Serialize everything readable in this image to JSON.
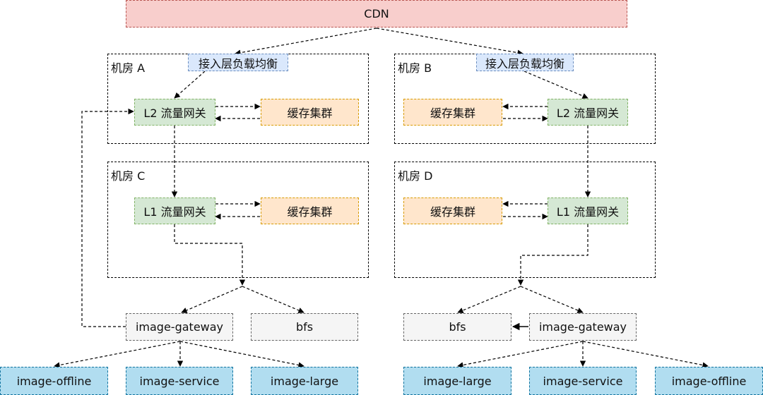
{
  "cdn": {
    "label": "CDN"
  },
  "room_a": {
    "label": "机房 A",
    "lb_label": "接入层负载均衡",
    "gw_label": "L2 流量网关",
    "cache_label": "缓存集群"
  },
  "room_b": {
    "label": "机房 B",
    "lb_label": "接入层负载均衡",
    "gw_label": "L2 流量网关",
    "cache_label": "缓存集群"
  },
  "room_c": {
    "label": "机房 C",
    "gw_label": "L1 流量网关",
    "cache_label": "缓存集群"
  },
  "room_d": {
    "label": "机房 D",
    "gw_label": "L1 流量网关",
    "cache_label": "缓存集群"
  },
  "left": {
    "image_gateway": "image-gateway",
    "bfs": "bfs",
    "image_offline": "image-offline",
    "image_service": "image-service",
    "image_large": "image-large"
  },
  "right": {
    "image_gateway": "image-gateway",
    "bfs": "bfs",
    "image_offline": "image-offline",
    "image_service": "image-service",
    "image_large": "image-large"
  },
  "colors": {
    "cdn": "#f8cecc",
    "lb": "#dae8fc",
    "gateway": "#d5e8d4",
    "cache": "#ffe6cc",
    "storage": "#f5f5f5",
    "service": "#b1ddf0"
  }
}
